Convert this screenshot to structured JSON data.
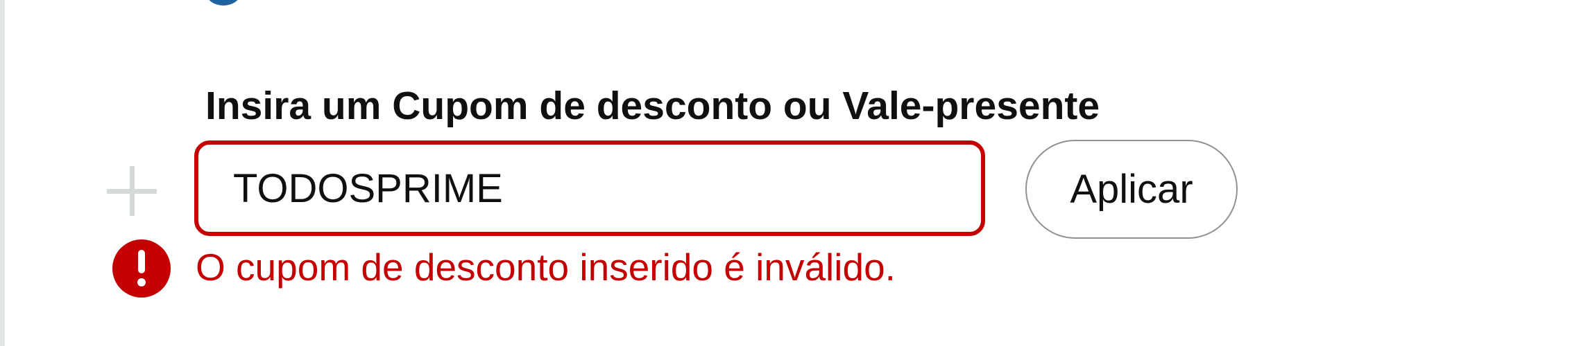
{
  "coupon": {
    "title": "Insira um Cupom de desconto ou Vale-presente",
    "input_value": "TODOSPRIME",
    "apply_label": "Aplicar",
    "error_message": "O cupom de desconto inserido é inválido."
  },
  "icons": {
    "expand": "plus-icon",
    "error": "error-circle-icon",
    "radio": "radio-button-icon"
  },
  "colors": {
    "error": "#c40000",
    "text": "#0f1111",
    "radio": "#2162a1",
    "icon_muted": "#d5d9d9",
    "button_border": "#8d9096"
  }
}
